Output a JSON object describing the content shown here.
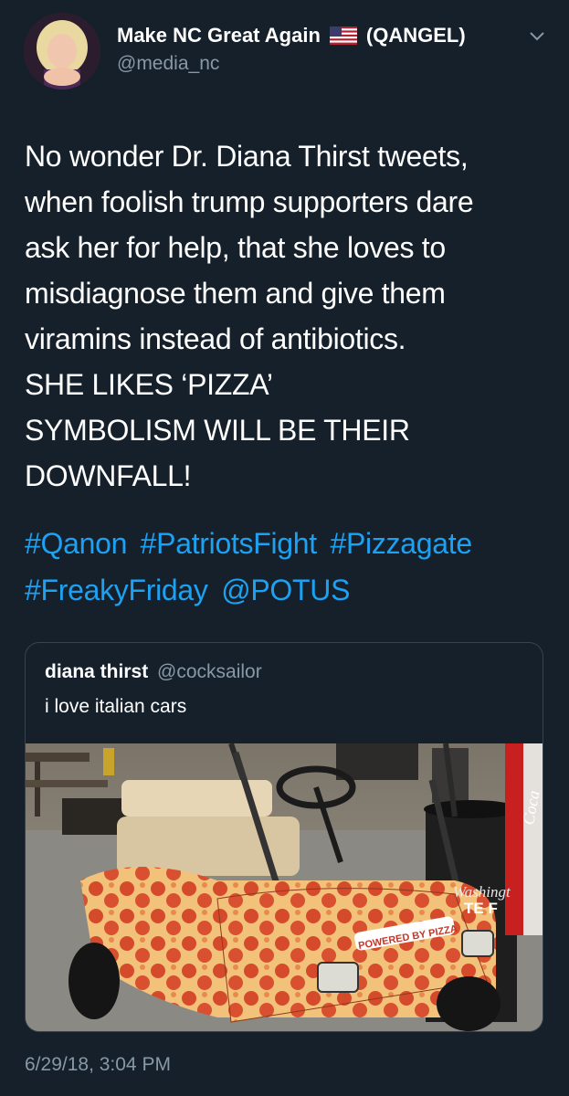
{
  "tweet": {
    "display_name": "Make NC Great Again",
    "name_suffix": "(QANGEL)",
    "handle": "@media_nc",
    "text_lines": [
      "No wonder Dr. Diana Thirst tweets,",
      "when foolish trump supporters dare",
      "ask her for help, that she loves to",
      "misdiagnose them and give them",
      "viramins instead of antibiotics.",
      "SHE LIKES ‘PIZZA’",
      "SYMBOLISM WILL BE THEIR",
      "DOWNFALL!"
    ],
    "hashtags": [
      "#Qanon",
      "#PatriotsFight",
      "#Pizzagate",
      "#FreakyFriday"
    ],
    "mention": "@POTUS",
    "timestamp": "6/29/18, 3:04 PM"
  },
  "quoted_tweet": {
    "name": "diana thirst",
    "handle": "@cocksailor",
    "text": "i love italian cars",
    "image_text": {
      "cart_decal": "POWERED BY PIZZA",
      "bin_text_1": "Washingt",
      "bin_text_2": "TE F",
      "machine_text": "Coca"
    }
  },
  "icons": {
    "flag": "us-flag-icon",
    "menu": "chevron-down-icon"
  },
  "colors": {
    "background": "#15202b",
    "link": "#1da1f2",
    "secondary_text": "#8899a6",
    "border": "#38444d"
  }
}
